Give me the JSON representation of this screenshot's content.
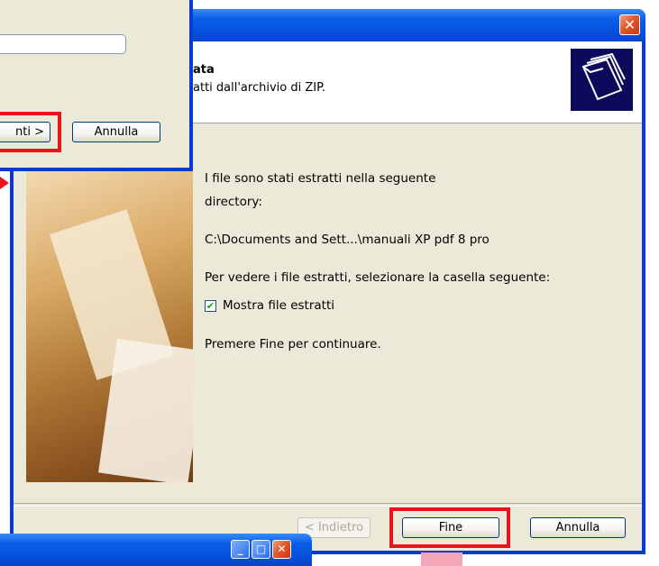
{
  "wizard": {
    "header_title": "ata",
    "header_subtitle": "atti dall'archivio di ZIP.",
    "close_glyph": "✕",
    "lines": {
      "extracted_to": "I file sono stati estratti nella seguente",
      "directory_label": "directory:",
      "path": "C:\\Documents and Sett...\\manuali XP pdf 8 pro",
      "instruction": "Per vedere i file estratti, selezionare la casella seguente:",
      "checkbox_label": "Mostra file estratti",
      "continue": "Premere Fine per continuare."
    },
    "checkbox_checked": true,
    "buttons": {
      "back": "< Indietro",
      "finish": "Fine",
      "cancel": "Annulla"
    }
  },
  "dialog": {
    "next_button": "nti >",
    "cancel_button": "Annulla"
  },
  "bottom_window": {
    "minimize": "_",
    "maximize": "□",
    "close": "✕"
  },
  "colors": {
    "highlight": "#e8141c",
    "xp_blue": "#0a3bd0",
    "face": "#ece9d8"
  }
}
